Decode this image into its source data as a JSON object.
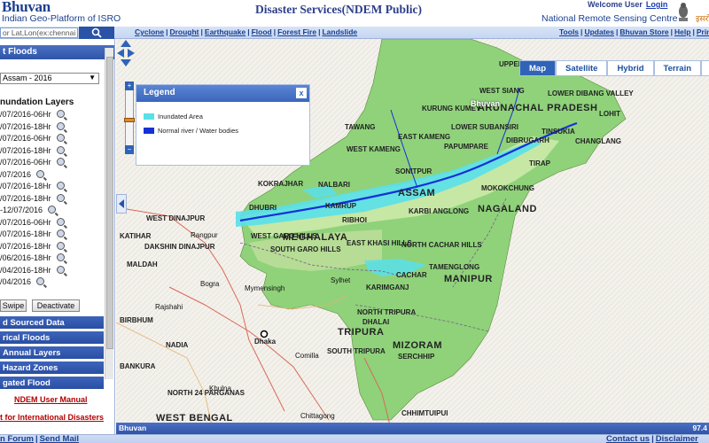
{
  "header": {
    "logo": "Bhuvan",
    "logo_subtitle": "Indian Geo-Platform of ISRO",
    "site_title": "Disaster Services(NDEM Public)",
    "welcome_text": "Welcome User",
    "login_label": "Login",
    "org_name": "National Remote Sensing Centre",
    "hindi_fragment": "इसरो"
  },
  "navbar": {
    "search_value": "or Lat,Lon(ex:chennai or",
    "main_links": [
      "Cyclone",
      "Drought",
      "Earthquake",
      "Flood",
      "Forest Fire",
      "Landslide"
    ],
    "right_links": [
      "Tools",
      "Updates",
      "Bhuvan Store",
      "Help",
      "Prin"
    ]
  },
  "left_panel": {
    "panel_title": "t Floods",
    "event_selected": "Assam - 2016",
    "layers_title": "nundation Layers",
    "layers": [
      "/07/2016-06Hr",
      "/07/2016-18Hr",
      "/07/2016-06Hr",
      "/07/2016-18Hr",
      "/07/2016-06Hr",
      "/07/2016",
      "/07/2016-18Hr",
      "/07/2016-18Hr",
      "-12/07/2016",
      "/07/2016-06Hr",
      "/07/2016-18Hr",
      "/07/2016-18Hr",
      "/06/2016-18Hr",
      "/04/2016-18Hr",
      "/04/2016"
    ],
    "swipe_label": "Swipe",
    "deactivate_label": "Deactivate",
    "sections": [
      "d Sourced Data",
      "rical Floods",
      "Annual Layers",
      "Hazard Zones",
      "gated Flood"
    ],
    "user_manual_link": "NDEM User Manual",
    "intl_link": "t for International Disasters"
  },
  "map": {
    "tabs": [
      {
        "label": "Map",
        "active": true
      },
      {
        "label": "Satellite",
        "active": false
      },
      {
        "label": "Hybrid",
        "active": false
      },
      {
        "label": "Terrain",
        "active": false
      },
      {
        "label": "M",
        "active": false
      }
    ],
    "legend": {
      "title": "Legend",
      "close_label": "x",
      "items": [
        {
          "label": "Inundated Area",
          "color": "#59e0ea"
        },
        {
          "label": "Normal river / Water bodies",
          "color": "#1530d8"
        }
      ]
    },
    "labels": {
      "big": [
        "ARUNACHAL PRADESH",
        "ASSAM",
        "NAGALAND",
        "MEGHALAYA",
        "MANIPUR",
        "TRIPURA",
        "MIZORAM",
        "WEST BENGAL"
      ],
      "districts": [
        "UPPER SUBANSIRI",
        "WEST SIANG",
        "LOWER DIBANG VALLEY",
        "KURUNG KUMEY",
        "LOHIT",
        "TAWANG",
        "LOWER SUBANSIRI",
        "DIBRUGARH",
        "TINSUKIA",
        "EAST KAMENG",
        "PAPUMPARE",
        "CHANGLANG",
        "WEST KAMENG",
        "TIRAP",
        "KOKRAJHAR",
        "NALBARI",
        "SONITPUR",
        "MOKOKCHUNG",
        "WEST DINAJPUR",
        "DHUBRI",
        "KAMRUP",
        "RIBHOI",
        "KARBI ANGLONG",
        "WEST GARO HILLS",
        "EAST KHASI HILLS",
        "NORTH CACHAR HILLS",
        "SOUTH GARO HILLS",
        "TAMENGLONG",
        "CACHAR",
        "KARIMGANJ",
        "NORTH TRIPURA",
        "DHALAI",
        "SOUTH TRIPURA",
        "SERCHHIP",
        "CHHIMTUIPUI",
        "DAKSHIN DINAJPUR",
        "KATIHAR",
        "BIRBHUM",
        "NADIA",
        "BANKURA",
        "MALDAH",
        "NORTH 24 PARGANAS"
      ],
      "cities": [
        "Rangpur",
        "Bogra",
        "Mymensingh",
        "Sylhet",
        "Rajshahi",
        "Dhaka",
        "Comilla",
        "Khulna",
        "Chittagong",
        "Bhuvan"
      ]
    },
    "footer_text": "Bhuvan",
    "scale_text": "97.4",
    "colors": {
      "land_green": "#8fd27a",
      "land_light": "#c7e7a5",
      "inundated": "#59e0ea",
      "water": "#1530d8",
      "accent_blue": "#2f55a9"
    }
  },
  "footer": {
    "left_links": [
      "n Forum",
      "Send Mail"
    ],
    "right_links": [
      "Contact us",
      "Disclaimer"
    ]
  }
}
